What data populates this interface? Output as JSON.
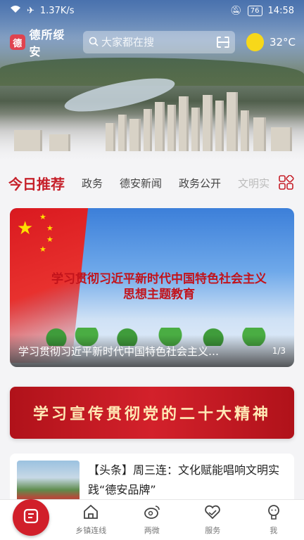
{
  "status_bar": {
    "network_speed": "1.37K/s",
    "battery": "76",
    "time": "14:58"
  },
  "header": {
    "logo_text": "德",
    "app_name": "德所绥安",
    "search_placeholder": "大家都在搜",
    "temperature": "32°C"
  },
  "tabs": [
    {
      "label": "今日推荐",
      "active": true
    },
    {
      "label": "政务"
    },
    {
      "label": "德安新闻"
    },
    {
      "label": "政务公开"
    },
    {
      "label": "文明实"
    }
  ],
  "banner": {
    "headline_line1": "学习贯彻习近平新时代中国特色社会主义",
    "headline_line2": "思想主题教育",
    "caption": "学习贯彻习近平新时代中国特色社会主义…",
    "pager": "1/3"
  },
  "slogan": {
    "text": "学习宣传贯彻党的二十大精神"
  },
  "news": {
    "title": "【头条】周三连：文化赋能唱响文明实践“德安品牌”"
  },
  "bottom_nav": [
    {
      "label": "乡镇连线",
      "icon": "home-outline-icon"
    },
    {
      "label": "两微",
      "icon": "weibo-icon"
    },
    {
      "label": "服务",
      "icon": "heart-hands-icon"
    },
    {
      "label": "我",
      "icon": "user-icon"
    }
  ],
  "colors": {
    "accent_red": "#c6202a",
    "sun_yellow": "#f7d81a"
  }
}
